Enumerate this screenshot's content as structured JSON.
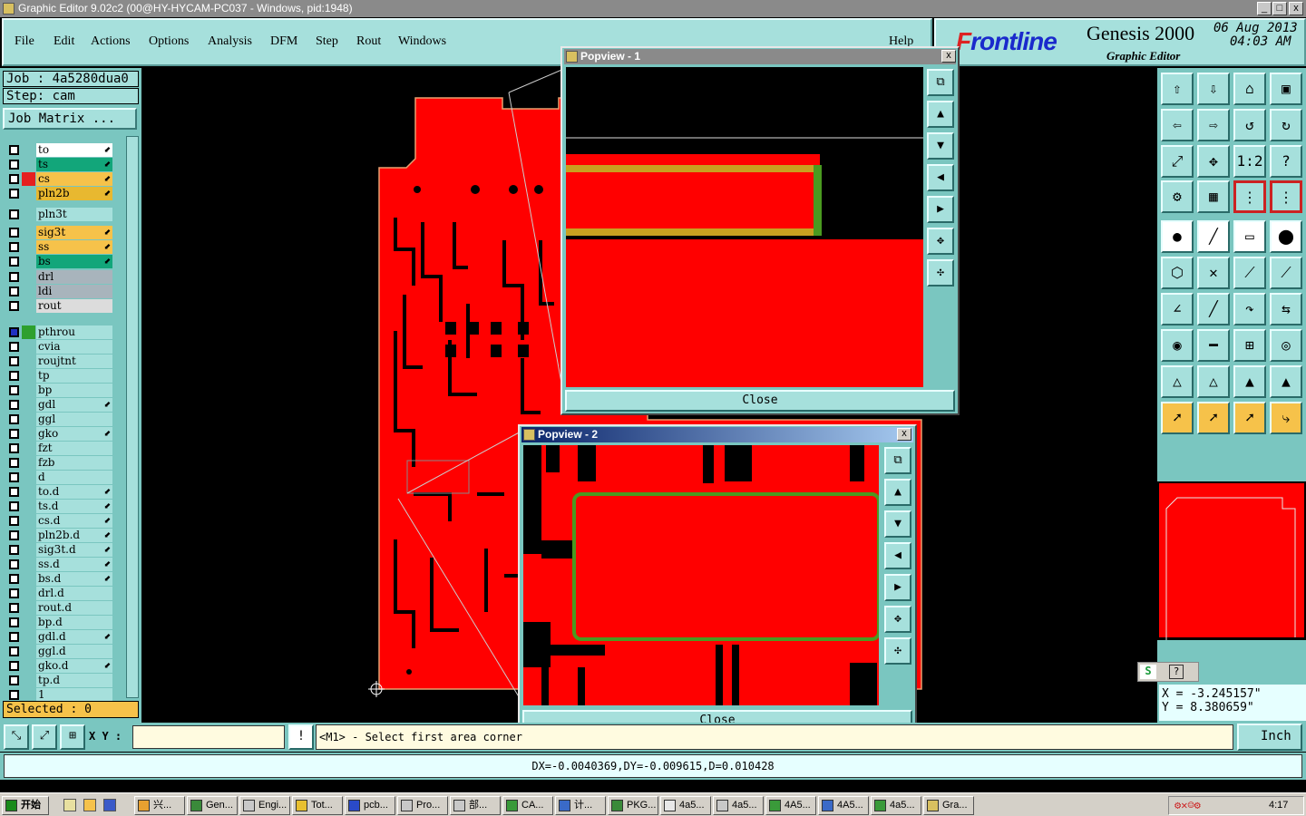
{
  "window": {
    "title": "Graphic Editor 9.02c2 (00@HY-HYCAM-PC037 - Windows, pid:1948)",
    "min": "_",
    "max": "□",
    "close": "x"
  },
  "menu": [
    "File",
    "Edit",
    "Actions",
    "Options",
    "Analysis",
    "DFM",
    "Step",
    "Rout",
    "Windows"
  ],
  "help": "Help",
  "brand": {
    "logo_f": "F",
    "logo_rest": "rontline",
    "product": "Genesis 2000",
    "subtitle": "Graphic Editor",
    "date": "06 Aug 2013",
    "time": "04:03 AM"
  },
  "job": {
    "job_label": "Job : 4a5280dua0",
    "step_label": "Step: cam",
    "job_matrix": "Job Matrix ..."
  },
  "layers": [
    {
      "name": "to",
      "color": "#ffffff",
      "arrow": true
    },
    {
      "name": "ts",
      "color": "#12a67a",
      "arrow": true
    },
    {
      "name": "cs",
      "color": "#f6c24a",
      "arrow": true,
      "swatch": "#e52020"
    },
    {
      "name": "pln2b",
      "color": "#e8b830",
      "arrow": true
    },
    {
      "name": "pln3t",
      "color": "#a6e0dc",
      "arrow": false
    },
    {
      "name": "sig3t",
      "color": "#f6c24a",
      "arrow": true
    },
    {
      "name": "ss",
      "color": "#f6c24a",
      "arrow": true
    },
    {
      "name": "bs",
      "color": "#12a67a",
      "arrow": true
    },
    {
      "name": "drl",
      "color": "#a8b4bc",
      "arrow": false
    },
    {
      "name": "ldi",
      "color": "#a8b4bc",
      "arrow": false
    },
    {
      "name": "rout",
      "color": "#dcdcdc",
      "arrow": false
    },
    {
      "name": "pthrou",
      "color": "#a6e0dc",
      "arrow": false,
      "swatch": "#2ea02e"
    },
    {
      "name": "cvia",
      "color": "#a6e0dc",
      "arrow": false
    },
    {
      "name": "roujtnt",
      "color": "#a6e0dc",
      "arrow": false
    },
    {
      "name": "tp",
      "color": "#a6e0dc",
      "arrow": false
    },
    {
      "name": "bp",
      "color": "#a6e0dc",
      "arrow": false
    },
    {
      "name": "gdl",
      "color": "#a6e0dc",
      "arrow": true
    },
    {
      "name": "ggl",
      "color": "#a6e0dc",
      "arrow": false
    },
    {
      "name": "gko",
      "color": "#a6e0dc",
      "arrow": true
    },
    {
      "name": "fzt",
      "color": "#a6e0dc",
      "arrow": false
    },
    {
      "name": "fzb",
      "color": "#a6e0dc",
      "arrow": false
    },
    {
      "name": "d",
      "color": "#a6e0dc",
      "arrow": false
    },
    {
      "name": "to.d",
      "color": "#a6e0dc",
      "arrow": true
    },
    {
      "name": "ts.d",
      "color": "#a6e0dc",
      "arrow": true
    },
    {
      "name": "cs.d",
      "color": "#a6e0dc",
      "arrow": true
    },
    {
      "name": "pln2b.d",
      "color": "#a6e0dc",
      "arrow": true
    },
    {
      "name": "sig3t.d",
      "color": "#a6e0dc",
      "arrow": true
    },
    {
      "name": "ss.d",
      "color": "#a6e0dc",
      "arrow": true
    },
    {
      "name": "bs.d",
      "color": "#a6e0dc",
      "arrow": true
    },
    {
      "name": "drl.d",
      "color": "#a6e0dc",
      "arrow": false
    },
    {
      "name": "rout.d",
      "color": "#a6e0dc",
      "arrow": false
    },
    {
      "name": "bp.d",
      "color": "#a6e0dc",
      "arrow": false
    },
    {
      "name": "gdl.d",
      "color": "#a6e0dc",
      "arrow": true
    },
    {
      "name": "ggl.d",
      "color": "#a6e0dc",
      "arrow": false
    },
    {
      "name": "gko.d",
      "color": "#a6e0dc",
      "arrow": true
    },
    {
      "name": "tp.d",
      "color": "#a6e0dc",
      "arrow": false
    },
    {
      "name": "1",
      "color": "#a6e0dc",
      "arrow": false
    }
  ],
  "selected": "Selected : 0",
  "bottom": {
    "xy_label": "X Y :",
    "xy_value": "",
    "prompt": "<M1> - Select first area corner",
    "unit": "Inch"
  },
  "status": "DX=-0.0040369,DY=-0.009615,D=0.010428",
  "coords": {
    "x": "X = -3.245157\"",
    "y": "Y = 8.380659\""
  },
  "popview1": {
    "title": "Popview - 1",
    "close": "Close"
  },
  "popview2": {
    "title": "Popview - 2",
    "close": "Close"
  },
  "taskbar": {
    "start": "开始",
    "items": [
      "兴...",
      "Gen...",
      "Engi...",
      "Tot...",
      "pcb...",
      "Pro...",
      "部...",
      "CA...",
      "计...",
      "PKG...",
      "4a5...",
      "4a5...",
      "4A5...",
      "4A5...",
      "4a5...",
      "Gra..."
    ],
    "clock": "4:17"
  },
  "colors": {
    "copper": "#ff0000",
    "panel": "#7ac6c0",
    "button": "#a6e0dc",
    "highlight": "#f6c24a"
  }
}
